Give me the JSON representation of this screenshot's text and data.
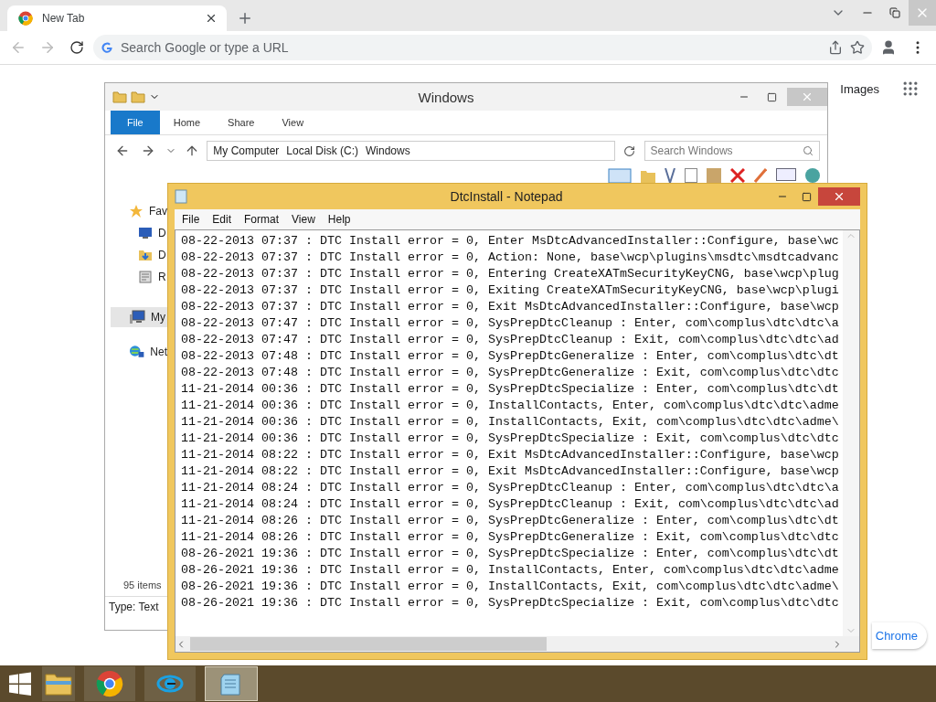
{
  "browser": {
    "tabs": [
      {
        "title": "New Tab",
        "selected": true
      }
    ],
    "omnibox": {
      "placeholder": "Search Google or type a URL"
    },
    "page": {
      "links": [
        "Images"
      ],
      "customize_button": "Chrome"
    }
  },
  "explorer": {
    "title": "Windows",
    "ribbon_tabs": [
      {
        "label": "File",
        "kind": "file"
      },
      {
        "label": "Home",
        "kind": "tab"
      },
      {
        "label": "Share",
        "kind": "tab"
      },
      {
        "label": "View",
        "kind": "tab"
      }
    ],
    "breadcrumb": [
      "My Computer",
      "Local Disk (C:)",
      "Windows"
    ],
    "search": {
      "placeholder": "Search Windows"
    },
    "nav_items": [
      {
        "label": "Fav",
        "kind": "favorites",
        "selected": false
      },
      {
        "label": "D",
        "kind": "desktop",
        "selected": false
      },
      {
        "label": "D",
        "kind": "downloads",
        "selected": false
      },
      {
        "label": "R",
        "kind": "recent",
        "selected": false
      },
      {
        "label": "My",
        "kind": "computer",
        "selected": true
      },
      {
        "label": "Net",
        "kind": "network",
        "selected": false
      }
    ],
    "item_count": "95 items",
    "details": "Type: Text"
  },
  "notepad": {
    "title": "DtcInstall - Notepad",
    "menu": [
      "File",
      "Edit",
      "Format",
      "View",
      "Help"
    ],
    "lines": [
      "08-22-2013 07:37 : DTC Install error = 0, Enter MsDtcAdvancedInstaller::Configure, base\\wc",
      "08-22-2013 07:37 : DTC Install error = 0, Action: None, base\\wcp\\plugins\\msdtc\\msdtcadvanc",
      "08-22-2013 07:37 : DTC Install error = 0, Entering CreateXATmSecurityKeyCNG, base\\wcp\\plug",
      "08-22-2013 07:37 : DTC Install error = 0, Exiting CreateXATmSecurityKeyCNG, base\\wcp\\plugi",
      "08-22-2013 07:37 : DTC Install error = 0, Exit MsDtcAdvancedInstaller::Configure, base\\wcp",
      "08-22-2013 07:47 : DTC Install error = 0, SysPrepDtcCleanup : Enter, com\\complus\\dtc\\dtc\\a",
      "08-22-2013 07:47 : DTC Install error = 0, SysPrepDtcCleanup : Exit, com\\complus\\dtc\\dtc\\ad",
      "08-22-2013 07:48 : DTC Install error = 0, SysPrepDtcGeneralize : Enter, com\\complus\\dtc\\dt",
      "08-22-2013 07:48 : DTC Install error = 0, SysPrepDtcGeneralize : Exit, com\\complus\\dtc\\dtc",
      "11-21-2014 00:36 : DTC Install error = 0, SysPrepDtcSpecialize : Enter, com\\complus\\dtc\\dt",
      "11-21-2014 00:36 : DTC Install error = 0, InstallContacts, Enter, com\\complus\\dtc\\dtc\\adme",
      "11-21-2014 00:36 : DTC Install error = 0, InstallContacts, Exit, com\\complus\\dtc\\dtc\\adme\\",
      "11-21-2014 00:36 : DTC Install error = 0, SysPrepDtcSpecialize : Exit, com\\complus\\dtc\\dtc",
      "11-21-2014 08:22 : DTC Install error = 0, Exit MsDtcAdvancedInstaller::Configure, base\\wcp",
      "11-21-2014 08:22 : DTC Install error = 0, Exit MsDtcAdvancedInstaller::Configure, base\\wcp",
      "11-21-2014 08:24 : DTC Install error = 0, SysPrepDtcCleanup : Enter, com\\complus\\dtc\\dtc\\a",
      "11-21-2014 08:24 : DTC Install error = 0, SysPrepDtcCleanup : Exit, com\\complus\\dtc\\dtc\\ad",
      "11-21-2014 08:26 : DTC Install error = 0, SysPrepDtcGeneralize : Enter, com\\complus\\dtc\\dt",
      "11-21-2014 08:26 : DTC Install error = 0, SysPrepDtcGeneralize : Exit, com\\complus\\dtc\\dtc",
      "08-26-2021 19:36 : DTC Install error = 0, SysPrepDtcSpecialize : Enter, com\\complus\\dtc\\dt",
      "08-26-2021 19:36 : DTC Install error = 0, InstallContacts, Enter, com\\complus\\dtc\\dtc\\adme",
      "08-26-2021 19:36 : DTC Install error = 0, InstallContacts, Exit, com\\complus\\dtc\\dtc\\adme\\",
      "08-26-2021 19:36 : DTC Install error = 0, SysPrepDtcSpecialize : Exit, com\\complus\\dtc\\dtc"
    ]
  },
  "taskbar": {
    "apps": [
      {
        "kind": "explorer",
        "selected": false
      },
      {
        "kind": "chrome",
        "selected": false
      },
      {
        "kind": "ie",
        "selected": false
      },
      {
        "kind": "notepad",
        "selected": true
      }
    ]
  }
}
